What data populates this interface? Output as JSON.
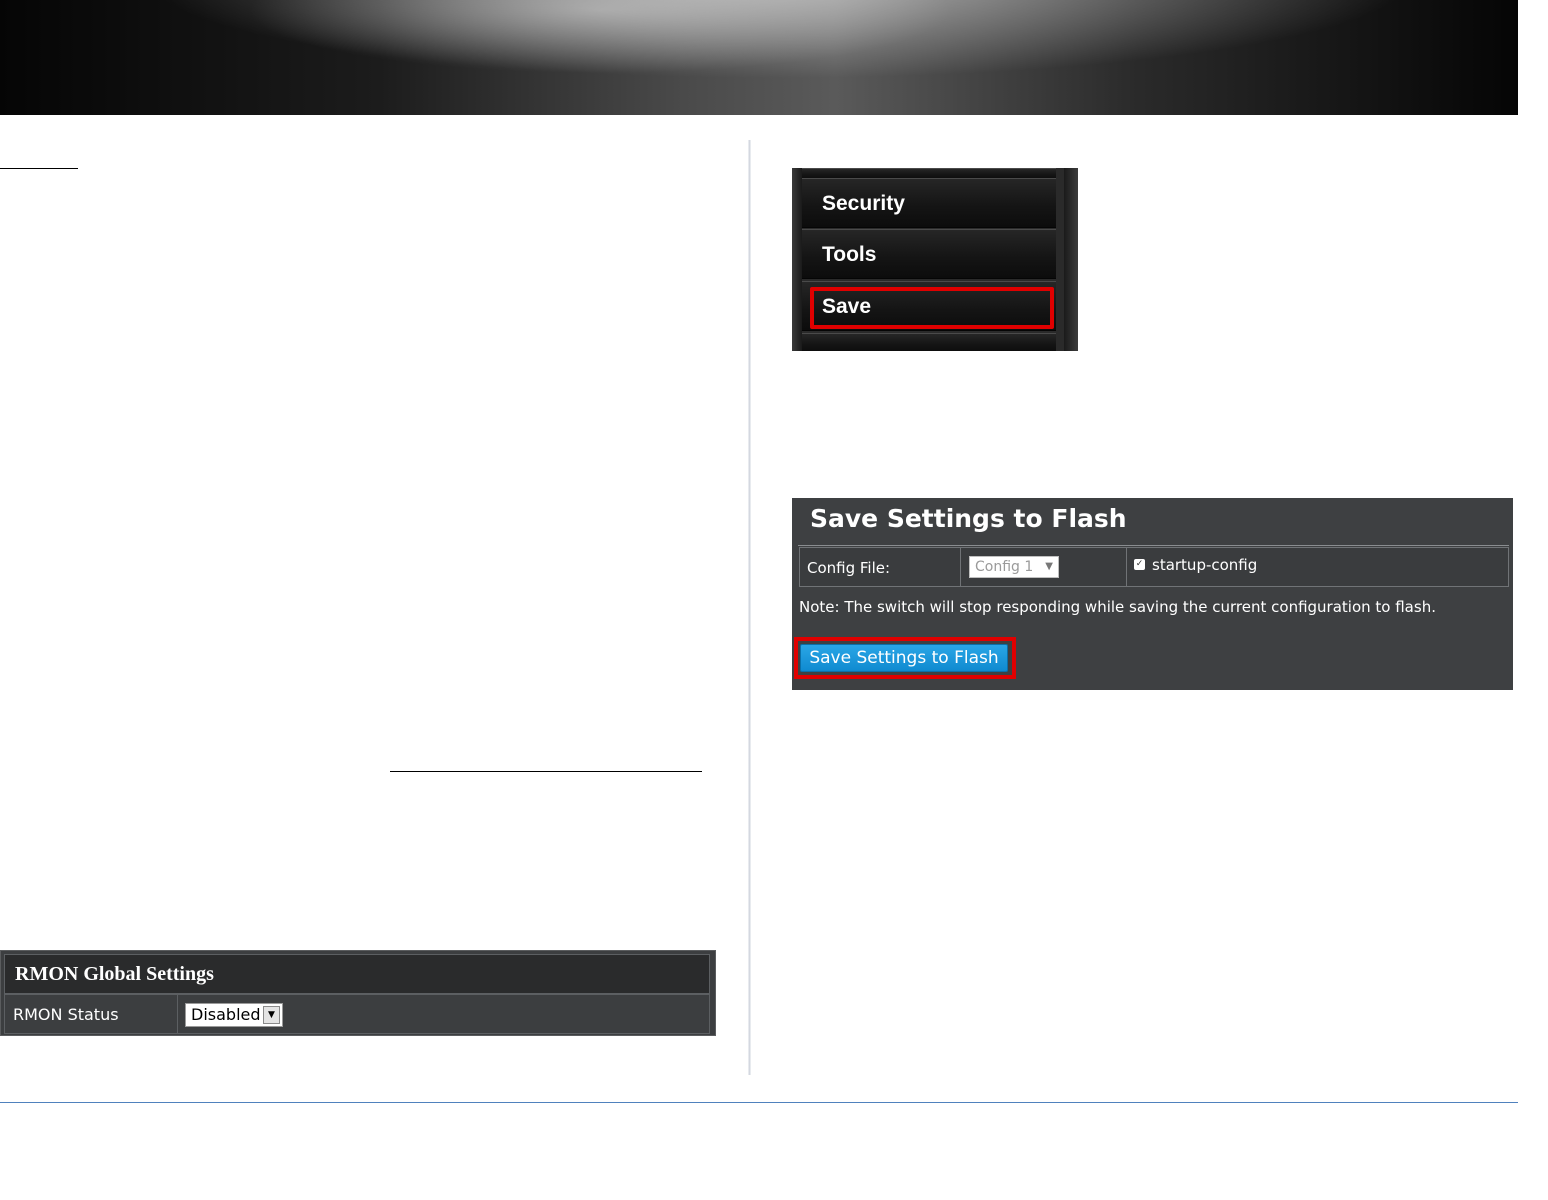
{
  "menu": {
    "items": [
      {
        "label": "Security"
      },
      {
        "label": "Tools"
      },
      {
        "label": "Save"
      }
    ],
    "highlight_color": "#e00000"
  },
  "save_panel": {
    "title": "Save Settings to Flash",
    "config_file_label": "Config File:",
    "config_select_value": "Config 1",
    "startup_checkbox_label": "startup-config",
    "startup_checked": true,
    "note": "Note: The switch will stop responding while saving the current configuration to flash.",
    "button_label": "Save Settings to Flash",
    "button_color": "#0f8ad0"
  },
  "rmon": {
    "title": "RMON Global Settings",
    "status_label": "RMON Status",
    "status_value": "Disabled"
  },
  "colors": {
    "panel_bg": "#3e4042",
    "footer_rule": "#4f81bd"
  }
}
